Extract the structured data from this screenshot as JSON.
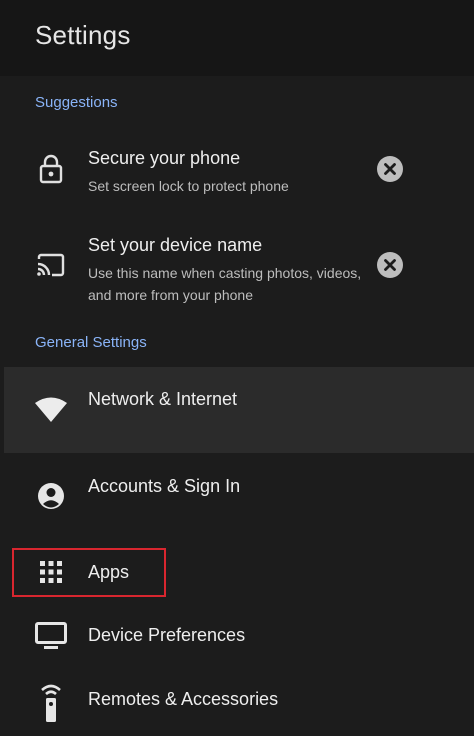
{
  "header": {
    "title": "Settings"
  },
  "suggestions": {
    "label": "Suggestions",
    "items": [
      {
        "title": "Secure your phone",
        "subtitle": "Set screen lock to protect phone",
        "icon": "lock-icon",
        "dismiss_icon": "close-circle-icon"
      },
      {
        "title": "Set your device name",
        "subtitle": "Use this name when casting photos, videos, and more from your phone",
        "icon": "cast-icon",
        "dismiss_icon": "close-circle-icon"
      }
    ]
  },
  "general": {
    "label": "General Settings",
    "items": [
      {
        "title": "Network & Internet",
        "icon": "wifi-icon"
      },
      {
        "title": "Accounts & Sign In",
        "icon": "account-icon"
      },
      {
        "title": "Apps",
        "icon": "apps-grid-icon"
      },
      {
        "title": "Device Preferences",
        "icon": "tv-icon"
      },
      {
        "title": "Remotes & Accessories",
        "icon": "remote-icon"
      }
    ]
  },
  "colors": {
    "background": "#1c1c1c",
    "section_label": "#8ab4f8",
    "focused_row": "#2b2b2b",
    "annotation_box": "#d8262f"
  }
}
